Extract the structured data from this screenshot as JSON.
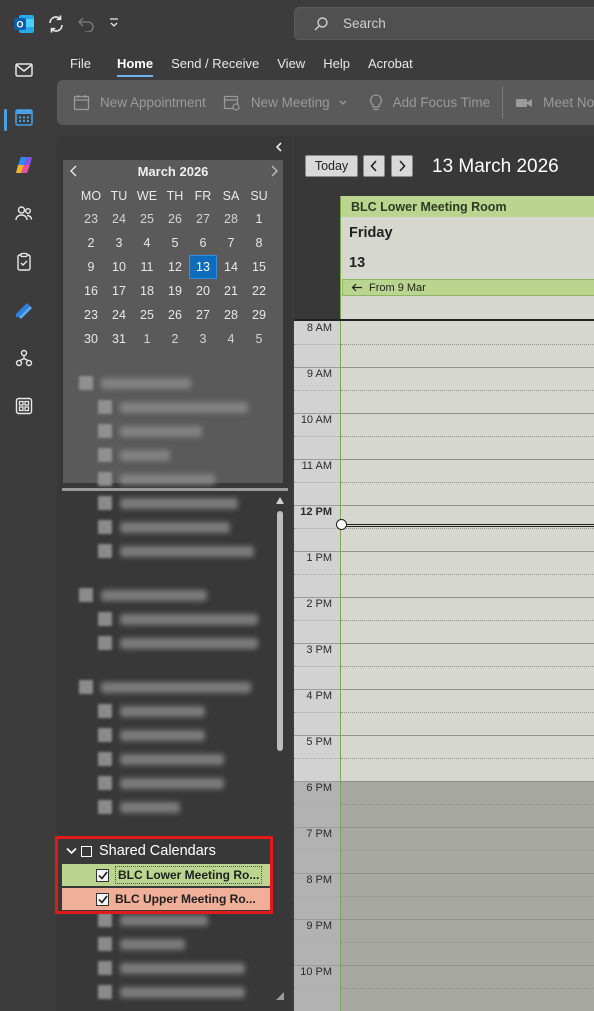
{
  "app": {
    "accent": "#0f6cbd",
    "today_color": "#0f6cbd"
  },
  "titlebar": {
    "icons": [
      "outlook-logo-icon",
      "sync-icon",
      "undo-icon",
      "customize-qat-icon"
    ],
    "search": {
      "label": "Search",
      "icon": "search-icon"
    }
  },
  "rail": {
    "items": [
      {
        "name": "mail",
        "icon": "mail-icon"
      },
      {
        "name": "calendar",
        "icon": "calendar-icon",
        "active": true
      },
      {
        "name": "copilot",
        "icon": "copilot-icon"
      },
      {
        "name": "people",
        "icon": "people-icon"
      },
      {
        "name": "tasks",
        "icon": "tasks-icon"
      },
      {
        "name": "todo",
        "icon": "todo-icon"
      },
      {
        "name": "org",
        "icon": "org-explorer-icon"
      },
      {
        "name": "apps",
        "icon": "apps-icon"
      }
    ]
  },
  "menu": {
    "tabs": [
      "File",
      "Home",
      "Send / Receive",
      "View",
      "Help",
      "Acrobat"
    ],
    "active": "Home"
  },
  "ribbon": {
    "new_appointment": "New Appointment",
    "new_meeting": "New Meeting",
    "new_focus_time": "Add Focus Time",
    "meet_now": "Meet Now"
  },
  "minical": {
    "title": "March 2026",
    "dow": [
      "MO",
      "TU",
      "WE",
      "TH",
      "FR",
      "SA",
      "SU"
    ],
    "weeks": [
      [
        "23",
        "24",
        "25",
        "26",
        "27",
        "28",
        "1"
      ],
      [
        "2",
        "3",
        "4",
        "5",
        "6",
        "7",
        "8"
      ],
      [
        "9",
        "10",
        "11",
        "12",
        "13",
        "14",
        "15"
      ],
      [
        "16",
        "17",
        "18",
        "19",
        "20",
        "21",
        "22"
      ],
      [
        "23",
        "24",
        "25",
        "26",
        "27",
        "28",
        "29"
      ],
      [
        "30",
        "31",
        "1",
        "2",
        "3",
        "4",
        "5"
      ]
    ],
    "today": "13"
  },
  "shared": {
    "header": "Shared Calendars",
    "items": [
      {
        "label": "BLC Lower Meeting Ro...",
        "checked": true,
        "color": "#b9d58f"
      },
      {
        "label": "BLC Upper Meeting Ro...",
        "checked": true,
        "color": "#efaf98"
      }
    ]
  },
  "calendar": {
    "today_btn": "Today",
    "date_title": "13 March 2026",
    "resource": "BLC Lower Meeting Room",
    "day_name": "Friday",
    "day_num": "13",
    "from_label": "From 9 Mar",
    "times": [
      "8 AM",
      "9 AM",
      "10 AM",
      "11 AM",
      "12 PM",
      "1 PM",
      "2 PM",
      "3 PM",
      "4 PM",
      "5 PM",
      "6 PM",
      "7 PM",
      "8 PM",
      "9 PM",
      "10 PM"
    ],
    "current_time_label": "12 PM"
  }
}
